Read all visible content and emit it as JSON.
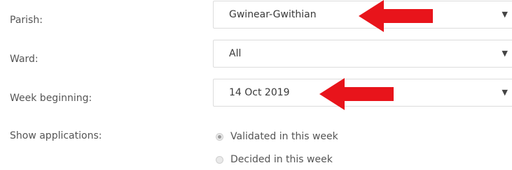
{
  "form": {
    "parish": {
      "label": "Parish:",
      "value": "Gwinear-Gwithian"
    },
    "ward": {
      "label": "Ward:",
      "value": "All"
    },
    "week": {
      "label": "Week beginning:",
      "value": "14 Oct 2019"
    },
    "show": {
      "label": "Show applications:",
      "options": [
        {
          "label": "Validated in this week",
          "checked": true
        },
        {
          "label": "Decided in this week",
          "checked": false
        }
      ]
    }
  },
  "annotation": {
    "arrow_color": "#e8141b"
  }
}
